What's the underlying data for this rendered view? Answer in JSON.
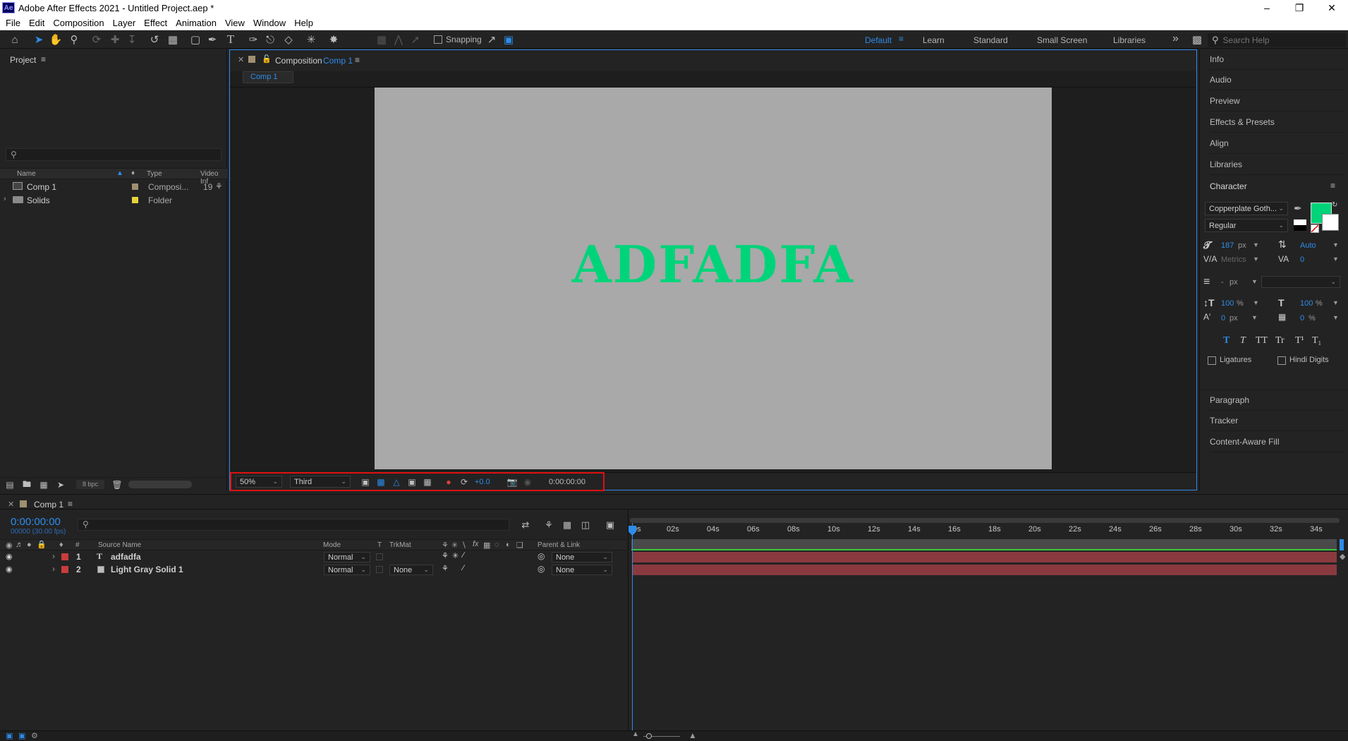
{
  "window": {
    "title": "Adobe After Effects 2021 - Untitled Project.aep *",
    "logo": "Ae",
    "minimize": "–",
    "restore": "❐",
    "close": "✕"
  },
  "menu": [
    "File",
    "Edit",
    "Composition",
    "Layer",
    "Effect",
    "Animation",
    "View",
    "Window",
    "Help"
  ],
  "toolbar": {
    "snapping_label": "Snapping",
    "workspaces": [
      "Default",
      "Learn",
      "Standard",
      "Small Screen",
      "Libraries"
    ],
    "active_workspace": "Default",
    "more": "»",
    "search_placeholder": "Search Help"
  },
  "project": {
    "title": "Project",
    "menu_icon": "≡",
    "search_placeholder": "",
    "columns": {
      "name": "Name",
      "type": "Type",
      "video": "Video Inf"
    },
    "items": [
      {
        "name": "Comp 1",
        "type": "Composi...",
        "video": "19",
        "color": "#a09070",
        "icon": "composition-icon"
      },
      {
        "name": "Solids",
        "type": "Folder",
        "video": "",
        "color": "#e6d23c",
        "icon": "folder-icon"
      }
    ],
    "bpc": "8 bpc"
  },
  "composition": {
    "header_prefix": "Composition",
    "header_name": "Comp 1",
    "tab": "Comp 1",
    "canvas_text": "ADFADFA",
    "canvas_text_color": "#00d47a",
    "canvas_bg": "#a9a9a9",
    "zoom": "50%",
    "resolution": "Third",
    "exposure": "+0.0",
    "timecode": "0:00:00:00"
  },
  "right_panels": {
    "info": "Info",
    "audio": "Audio",
    "preview": "Preview",
    "effects": "Effects & Presets",
    "align": "Align",
    "libraries": "Libraries",
    "character": "Character",
    "paragraph": "Paragraph",
    "tracker": "Tracker",
    "content_fill": "Content-Aware Fill"
  },
  "character": {
    "font_family": "Copperplate Goth...",
    "font_style": "Regular",
    "font_size": "187",
    "font_size_unit": "px",
    "leading": "Auto",
    "kerning": "Metrics",
    "tracking": "0",
    "stroke_width": "-",
    "stroke_unit": "px",
    "vscale": "100",
    "vscale_unit": "%",
    "hscale": "100",
    "hscale_unit": "%",
    "baseline": "0",
    "baseline_unit": "px",
    "tsume": "0",
    "tsume_unit": "%",
    "fill_color": "#00d47a",
    "styles": [
      "T",
      "T",
      "TT",
      "Tr",
      "T¹",
      "T₁"
    ],
    "ligatures": "Ligatures",
    "hindi_digits": "Hindi Digits"
  },
  "timeline": {
    "tab": "Comp 1",
    "timecode": "0:00:00:00",
    "frame_info": "00000 (30.00 fps)",
    "columns": {
      "num": "#",
      "source": "Source Name",
      "mode": "Mode",
      "t": "T",
      "trkmat": "TrkMat",
      "parent": "Parent & Link"
    },
    "layers": [
      {
        "num": "1",
        "type_icon": "T",
        "name": "adfadfa",
        "mode": "Normal",
        "trkmat": "",
        "parent": "None",
        "label_color": "#c83c3c"
      },
      {
        "num": "2",
        "type_icon": "",
        "name": "Light Gray Solid 1",
        "mode": "Normal",
        "trkmat": "None",
        "parent": "None",
        "label_color": "#c83c3c"
      }
    ],
    "ticks": [
      "0s",
      "02s",
      "04s",
      "06s",
      "08s",
      "10s",
      "12s",
      "14s",
      "16s",
      "18s",
      "20s",
      "22s",
      "24s",
      "26s",
      "28s",
      "30s",
      "32s",
      "34s"
    ]
  }
}
